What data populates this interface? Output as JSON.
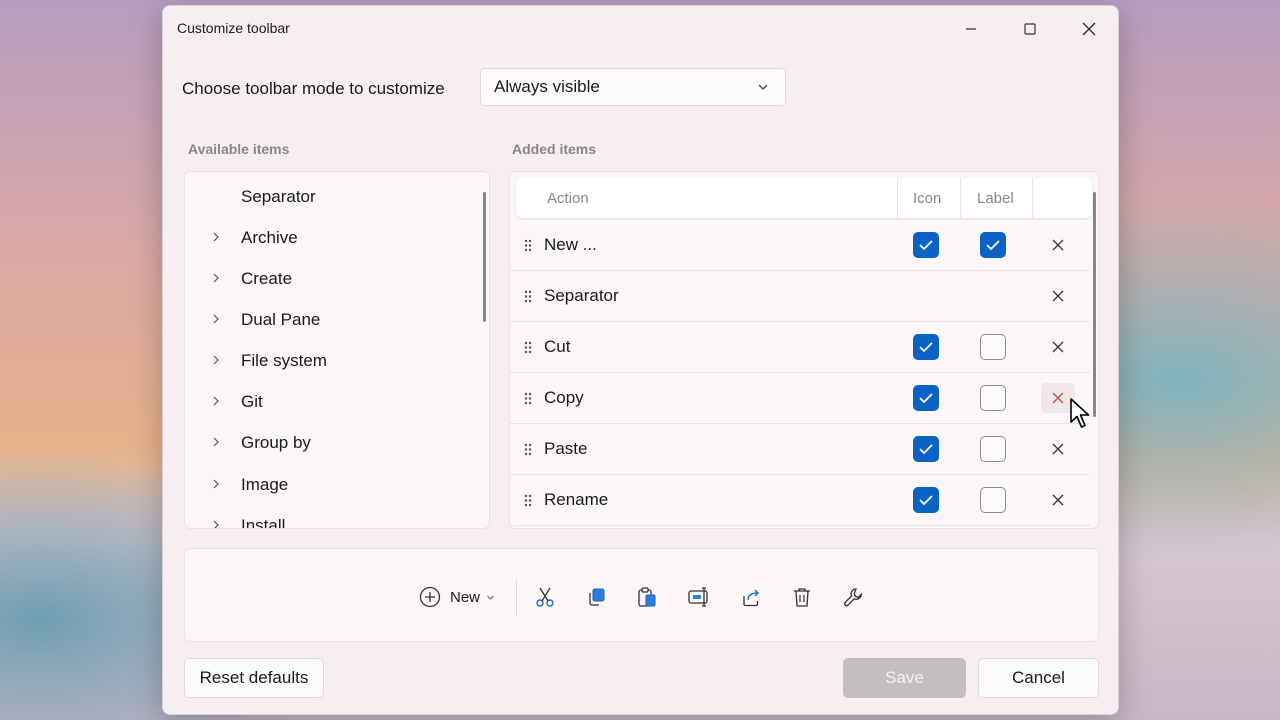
{
  "window": {
    "title": "Customize toolbar",
    "controls": [
      "minimize-icon",
      "maximize-icon",
      "close-icon"
    ]
  },
  "mode": {
    "label": "Choose toolbar mode to customize",
    "selected": "Always visible",
    "icon": "chevron-down-icon"
  },
  "available": {
    "header": "Available items",
    "items": [
      {
        "label": "Separator",
        "expandable": false
      },
      {
        "label": "Archive",
        "expandable": true
      },
      {
        "label": "Create",
        "expandable": true
      },
      {
        "label": "Dual Pane",
        "expandable": true
      },
      {
        "label": "File system",
        "expandable": true
      },
      {
        "label": "Git",
        "expandable": true
      },
      {
        "label": "Group by",
        "expandable": true
      },
      {
        "label": "Image",
        "expandable": true
      },
      {
        "label": "Install",
        "expandable": true
      }
    ]
  },
  "added": {
    "header": "Added items",
    "columns": {
      "action": "Action",
      "icon": "Icon",
      "label": "Label"
    },
    "rows": [
      {
        "name": "New ...",
        "icon": true,
        "label": true
      },
      {
        "name": "Separator",
        "icon": null,
        "label": null
      },
      {
        "name": "Cut",
        "icon": true,
        "label": false
      },
      {
        "name": "Copy",
        "icon": true,
        "label": false,
        "remove_hovered": true
      },
      {
        "name": "Paste",
        "icon": true,
        "label": false
      },
      {
        "name": "Rename",
        "icon": true,
        "label": false
      }
    ]
  },
  "preview": {
    "new_label": "New",
    "icons": [
      "add-circle-icon",
      "cut-icon",
      "copy-icon",
      "paste-icon",
      "rename-icon",
      "share-icon",
      "delete-icon",
      "properties-wrench-icon"
    ]
  },
  "footer": {
    "reset_label": "Reset defaults",
    "save_label": "Save",
    "save_enabled": false,
    "cancel_label": "Cancel"
  },
  "colors": {
    "accent": "#0a63c4",
    "remove_hover": "#d64545",
    "window_bg": "#f7eef1"
  }
}
